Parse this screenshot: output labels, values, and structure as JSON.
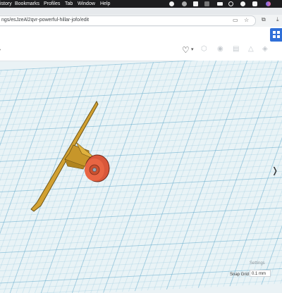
{
  "menubar": {
    "items": [
      "istory",
      "Bookmarks",
      "Profiles",
      "Tab",
      "Window",
      "Help"
    ]
  },
  "browser": {
    "url": "ngs/esJzeAl2qvr-powerful-hillar-jofo/edit"
  },
  "workplane": {
    "settings_label": "Settings",
    "snap_grid_label": "Snap Grid",
    "snap_grid_value": "0.1 mm"
  },
  "colors": {
    "accent": "#2f6fd8",
    "part_yellow": "#d4a12a",
    "part_orange": "#e15d3a"
  }
}
